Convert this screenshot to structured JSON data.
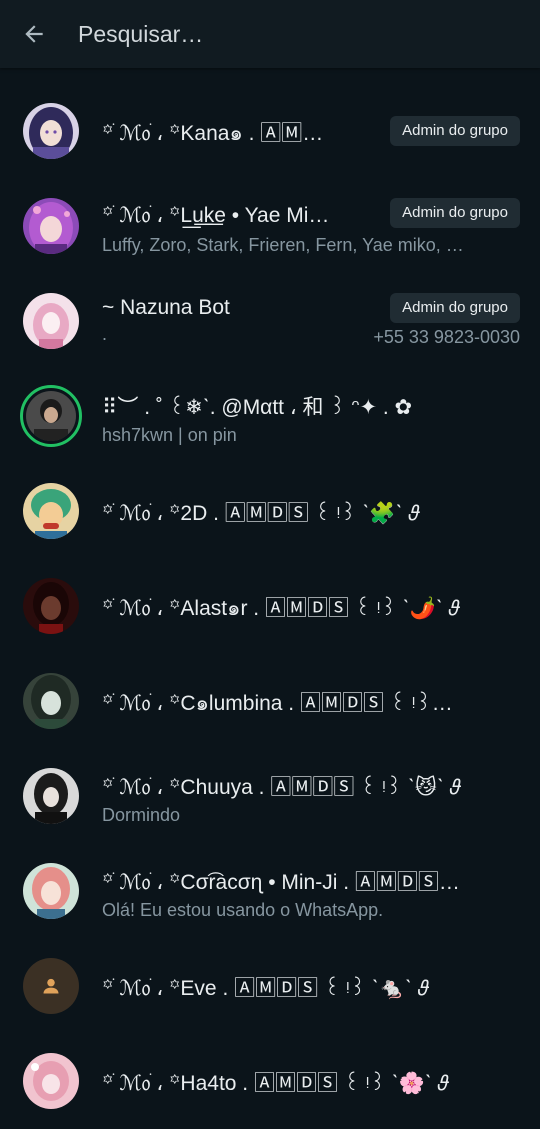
{
  "search": {
    "placeholder": "Pesquisar…",
    "back_icon": "arrow-left-icon"
  },
  "colors": {
    "background": "#0b141a",
    "header": "#111b21",
    "badge_bg": "#202c33",
    "status_ring": "#21c063",
    "secondary_text": "#8696a0"
  },
  "contacts": [
    {
      "name": "꙳ׁ ℳ᥆ֹ ، ꙳Kana๑ . 🄰🄼…",
      "badge": "Admin do grupo",
      "subtitle": ""
    },
    {
      "name": "꙳ׁ ℳ᥆ֹ ، ꙳L͟u͟k͟e • Yae Mi…",
      "badge": "Admin do grupo",
      "subtitle": "Luffy, Zoro, Stark, Frieren, Fern, Yae miko, …"
    },
    {
      "name": "~ Nazuna Bot",
      "badge": "Admin do grupo",
      "subtitle": ".",
      "phone": "+55 33 9823-0030"
    },
    {
      "name": "⠿︶ . ˚ ꒰❄︎ˋ. @Mαtt ، 和 ꒱ ᵔ✦ . ✿",
      "subtitle": "hsh7kwn | on pin",
      "status_ring": true
    },
    {
      "name": "꙳ׁ ℳ᥆ֹ ، ꙳2D . 🄰🄼🄳🅂 ꒰ ᵎ꒱ ˋ🧩ˋ 𝜗",
      "subtitle": ""
    },
    {
      "name": "꙳ׁ ℳ᥆ֹ ، ꙳Alast๑r . 🄰🄼🄳🅂 ꒰ ᵎ꒱ ˋ🌶️ˋ 𝜗",
      "subtitle": ""
    },
    {
      "name": "꙳ׁ ℳ᥆ֹ ، ꙳C๑lumbina . 🄰🄼🄳🅂 ꒰ ᵎ꒱…",
      "subtitle": ""
    },
    {
      "name": "꙳ׁ ℳ᥆ֹ ، ꙳Chuuya . 🄰🄼🄳🅂 ꒰ ᵎ꒱ ˋ😼ˋ 𝜗",
      "subtitle": "Dormindo"
    },
    {
      "name": "꙳ׁ ℳ᥆ֹ ، ꙳Cσr͡acσɳ • Min-Ji . 🄰🄼🄳🅂…",
      "subtitle": "Olá! Eu estou usando o WhatsApp."
    },
    {
      "name": "꙳ׁ ℳ᥆ֹ ، ꙳Eve . 🄰🄼🄳🅂 ꒰ ᵎ꒱ ˋ🐁ˋ 𝜗",
      "subtitle": "",
      "placeholder_avatar": true
    },
    {
      "name": "꙳ׁ ℳ᥆ֹ ، ꙳Ha4to . 🄰🄼🄳🅂 ꒰ ᵎ꒱ ˋ🌸ˋ 𝜗",
      "subtitle": ""
    }
  ]
}
